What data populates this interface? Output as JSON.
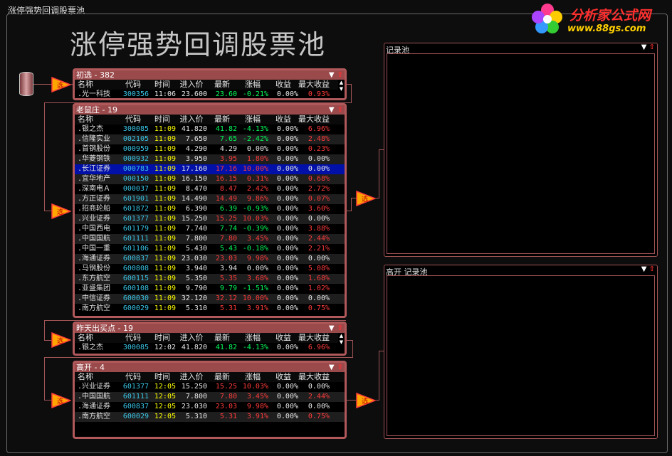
{
  "window": {
    "title": "涨停强势回调股票池"
  },
  "page": {
    "title": "涨停强势回调股票池"
  },
  "logo": {
    "line1": "分析家公式网",
    "line2": "www.88gs.com"
  },
  "columns": [
    "名称",
    "代码",
    "时间",
    "进入价",
    "最新",
    "涨幅",
    "收益",
    "最大收益"
  ],
  "pools": [
    {
      "title": "初选 - 382",
      "rows": [
        [
          "光一科技",
          "300356",
          "11:06",
          "23.600",
          "23.60",
          "-0.21%",
          "0.00%",
          "0.93%"
        ]
      ]
    },
    {
      "title": "老鼠庄 - 19",
      "rows": [
        [
          "银之杰",
          "300085",
          "11:09",
          "41.820",
          "41.82",
          "-4.13%",
          "0.00%",
          "6.96%"
        ],
        [
          "信隆实业",
          "002105",
          "11:09",
          "7.650",
          "7.65",
          "-2.42%",
          "0.00%",
          "2.48%"
        ],
        [
          "首钢股份",
          "000959",
          "11:09",
          "4.290",
          "4.29",
          "0.00%",
          "0.00%",
          "0.23%"
        ],
        [
          "华菱钢铁",
          "000932",
          "11:09",
          "3.950",
          "3.95",
          "1.80%",
          "0.00%",
          "0.00%"
        ],
        [
          "长江证券",
          "000783",
          "11:09",
          "17.160",
          "17.16",
          "10.00%",
          "0.00%",
          "0.00%"
        ],
        [
          "宜华地产",
          "000150",
          "11:09",
          "16.150",
          "16.15",
          "0.31%",
          "0.00%",
          "0.68%"
        ],
        [
          "深南电Ａ",
          "000037",
          "11:09",
          "8.470",
          "8.47",
          "2.42%",
          "0.00%",
          "2.72%"
        ],
        [
          "方正证券",
          "601901",
          "11:09",
          "14.490",
          "14.49",
          "9.86%",
          "0.00%",
          "0.07%"
        ],
        [
          "招商轮船",
          "601872",
          "11:09",
          "6.390",
          "6.39",
          "-0.93%",
          "0.00%",
          "3.60%"
        ],
        [
          "兴业证券",
          "601377",
          "11:09",
          "15.250",
          "15.25",
          "10.03%",
          "0.00%",
          "0.00%"
        ],
        [
          "中国西电",
          "601179",
          "11:09",
          "7.740",
          "7.74",
          "-0.39%",
          "0.00%",
          "3.88%"
        ],
        [
          "中国国航",
          "601111",
          "11:09",
          "7.800",
          "7.80",
          "3.45%",
          "0.00%",
          "2.44%"
        ],
        [
          "中国一重",
          "601106",
          "11:09",
          "5.430",
          "5.43",
          "-0.18%",
          "0.00%",
          "2.21%"
        ],
        [
          "海通证券",
          "600837",
          "11:09",
          "23.030",
          "23.03",
          "9.98%",
          "0.00%",
          "0.00%"
        ],
        [
          "马钢股份",
          "600808",
          "11:09",
          "3.940",
          "3.94",
          "0.00%",
          "0.00%",
          "5.08%"
        ],
        [
          "东方航空",
          "600115",
          "11:09",
          "5.350",
          "5.35",
          "3.68%",
          "0.00%",
          "1.68%"
        ],
        [
          "亚盛集团",
          "600108",
          "11:09",
          "9.790",
          "9.79",
          "-1.51%",
          "0.00%",
          "1.02%"
        ],
        [
          "中信证券",
          "600030",
          "11:09",
          "32.120",
          "32.12",
          "10.00%",
          "0.00%",
          "0.00%"
        ],
        [
          "南方航空",
          "600029",
          "11:09",
          "5.310",
          "5.31",
          "3.91%",
          "0.00%",
          "0.75%"
        ]
      ]
    },
    {
      "title": "昨天出买点 - 19",
      "rows": [
        [
          "银之杰",
          "300085",
          "12:02",
          "41.820",
          "41.82",
          "-4.13%",
          "0.00%",
          "6.96%"
        ]
      ]
    },
    {
      "title": "高开 - 4",
      "rows": [
        [
          "兴业证券",
          "601377",
          "12:05",
          "15.250",
          "15.25",
          "10.03%",
          "0.00%",
          "0.00%"
        ],
        [
          "中国国航",
          "601111",
          "12:05",
          "7.800",
          "7.80",
          "3.45%",
          "0.00%",
          "2.44%"
        ],
        [
          "海通证券",
          "600837",
          "12:05",
          "23.030",
          "23.03",
          "9.98%",
          "0.00%",
          "0.00%"
        ],
        [
          "南方航空",
          "600029",
          "12:05",
          "5.310",
          "5.31",
          "3.91%",
          "0.00%",
          "0.75%"
        ]
      ]
    }
  ],
  "records": [
    {
      "title": "记录池"
    },
    {
      "title": "高开 记录池"
    }
  ],
  "node_label": "选",
  "colors": {
    "frame": "#b0585a",
    "header": "#9b4a4c",
    "up": "#ff3b3b",
    "down": "#00ff5a",
    "code": "#39c5e6",
    "selected": "#0010a8"
  }
}
